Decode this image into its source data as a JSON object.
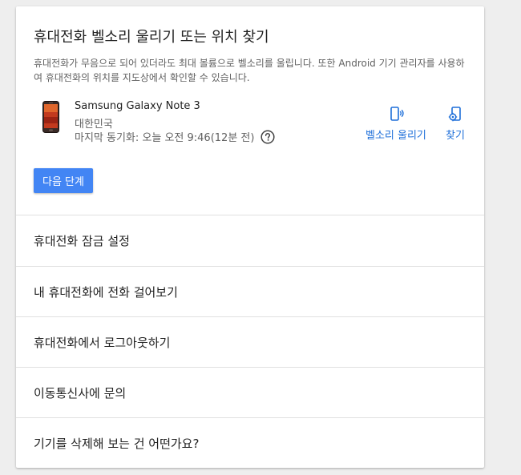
{
  "card": {
    "title": "휴대전화 벨소리 울리기 또는 위치 찾기",
    "description": "휴대전화가 무음으로 되어 있더라도 최대 볼륨으로 벨소리를 울립니다. 또한 Android 기기 관리자를 사용하여 휴대전화의 위치를 지도상에서 확인할 수 있습니다."
  },
  "device": {
    "image_icon": "phone-image",
    "name": "Samsung Galaxy Note 3",
    "country": "대한민국",
    "last_sync": "마지막 동기화: 오늘 오전 9:46(12분 전)",
    "help_icon": "help-circle-icon"
  },
  "actions": {
    "ring": {
      "label": "벨소리 울리기",
      "icon": "phone-ring-icon"
    },
    "find": {
      "label": "찾기",
      "icon": "locate-phone-icon"
    }
  },
  "next_button": "다음 단계",
  "menu": [
    {
      "label": "휴대전화 잠금 설정"
    },
    {
      "label": "내 휴대전화에 전화 걸어보기"
    },
    {
      "label": "휴대전화에서 로그아웃하기"
    },
    {
      "label": "이동통신사에 문의"
    },
    {
      "label": "기기를 삭제해 보는 건 어떤가요?"
    }
  ],
  "colors": {
    "accent": "#4285f4",
    "link": "#1e6fd9",
    "divider": "#e0e0e0"
  }
}
